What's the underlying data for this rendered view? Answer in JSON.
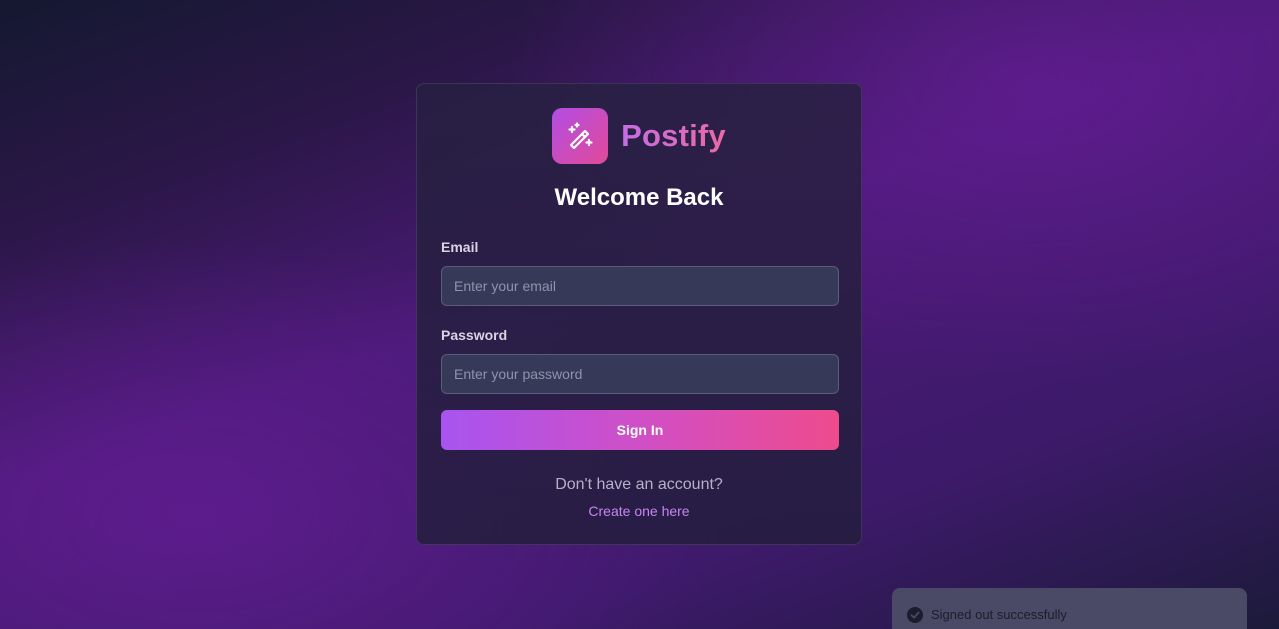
{
  "app": {
    "name": "Postify",
    "logo_icon": "magic-wand-icon"
  },
  "login": {
    "title": "Welcome Back",
    "email_label": "Email",
    "email_placeholder": "Enter your email",
    "email_value": "",
    "password_label": "Password",
    "password_placeholder": "Enter your password",
    "password_value": "",
    "submit_label": "Sign In",
    "signup_prompt": "Don't have an account?",
    "signup_link": "Create one here"
  },
  "toast": {
    "icon": "check-circle-icon",
    "message": "Signed out successfully"
  },
  "colors": {
    "accent_start": "#a854f0",
    "accent_end": "#ee4b8c",
    "link": "#c785f0"
  }
}
